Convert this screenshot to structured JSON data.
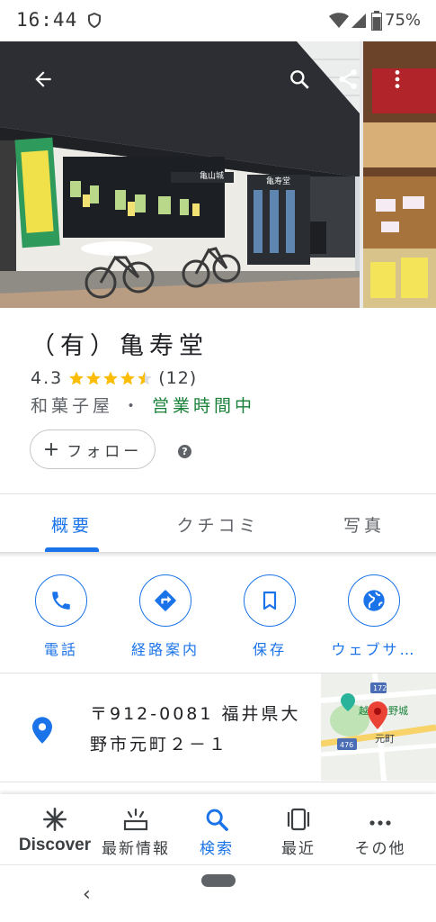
{
  "status_bar": {
    "time": "16:44",
    "battery": "75%"
  },
  "place": {
    "name": "（有）亀寿堂",
    "rating": "4.3",
    "stars_value": 4.3,
    "review_count": "(12)",
    "category": "和菓子屋",
    "separator": "・",
    "open_status": "営業時間中",
    "follow_label": "フォロー",
    "help_symbol": "?"
  },
  "photo_signs": {
    "sign1": "亀山城",
    "sign2": "亀寿堂"
  },
  "tabs": [
    {
      "label": "概要",
      "active": true
    },
    {
      "label": "クチコミ",
      "active": false
    },
    {
      "label": "写真",
      "active": false
    }
  ],
  "actions": [
    {
      "label": "電話",
      "icon": "phone-icon"
    },
    {
      "label": "経路案内",
      "icon": "directions-icon"
    },
    {
      "label": "保存",
      "icon": "bookmark-icon"
    },
    {
      "label": "ウェブサ…",
      "icon": "globe-icon"
    }
  ],
  "address": {
    "line1": "〒912-0081 福井県大",
    "line2": "野市元町２－１"
  },
  "map_thumb": {
    "poi_label": "越前大野城",
    "road1": "172",
    "road2": "476",
    "area": "元町"
  },
  "bottom_nav": [
    {
      "label": "Discover",
      "icon": "discover-icon",
      "active": false
    },
    {
      "label": "最新情報",
      "icon": "updates-icon",
      "active": false
    },
    {
      "label": "検索",
      "icon": "search-icon",
      "active": true
    },
    {
      "label": "最近",
      "icon": "recent-icon",
      "active": false
    },
    {
      "label": "その他",
      "icon": "more-icon",
      "active": false
    }
  ],
  "colors": {
    "accent": "#1a73e8",
    "open_green": "#188038",
    "star": "#fbbc04",
    "pin_blue": "#1a73e8",
    "map_pin_red": "#ea4335"
  }
}
